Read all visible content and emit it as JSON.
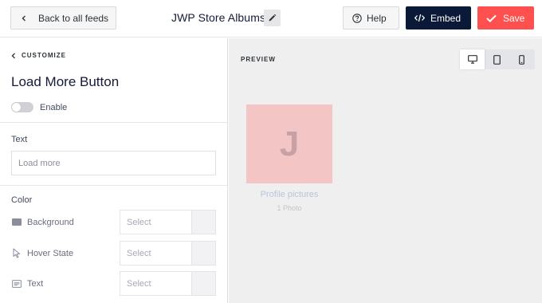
{
  "header": {
    "back_label": "Back to all feeds",
    "feed_title": "JWP Store Albums",
    "help_label": "Help",
    "embed_label": "Embed",
    "save_label": "Save"
  },
  "sidebar": {
    "breadcrumb": "CUSTOMIZE",
    "title": "Load More Button",
    "enable_label": "Enable",
    "enable_on": false,
    "text_section_label": "Text",
    "text_input_placeholder": "Load more",
    "color_section_label": "Color",
    "color_rows": [
      {
        "label": "Background",
        "icon": "background-swatch-icon",
        "value": "Select"
      },
      {
        "label": "Hover State",
        "icon": "cursor-icon",
        "value": "Select"
      },
      {
        "label": "Text",
        "icon": "text-icon",
        "value": "Select"
      }
    ]
  },
  "preview": {
    "label": "PREVIEW",
    "devices": [
      "desktop",
      "tablet",
      "mobile"
    ],
    "active_device": "desktop",
    "album": {
      "initial": "J",
      "title": "Profile pictures",
      "count": "1 Photo"
    }
  },
  "colors": {
    "embed_bg": "#0a1937",
    "save_bg": "#ff5050",
    "preview_bg": "#efeff0",
    "album_bg": "#f4c5c5"
  }
}
